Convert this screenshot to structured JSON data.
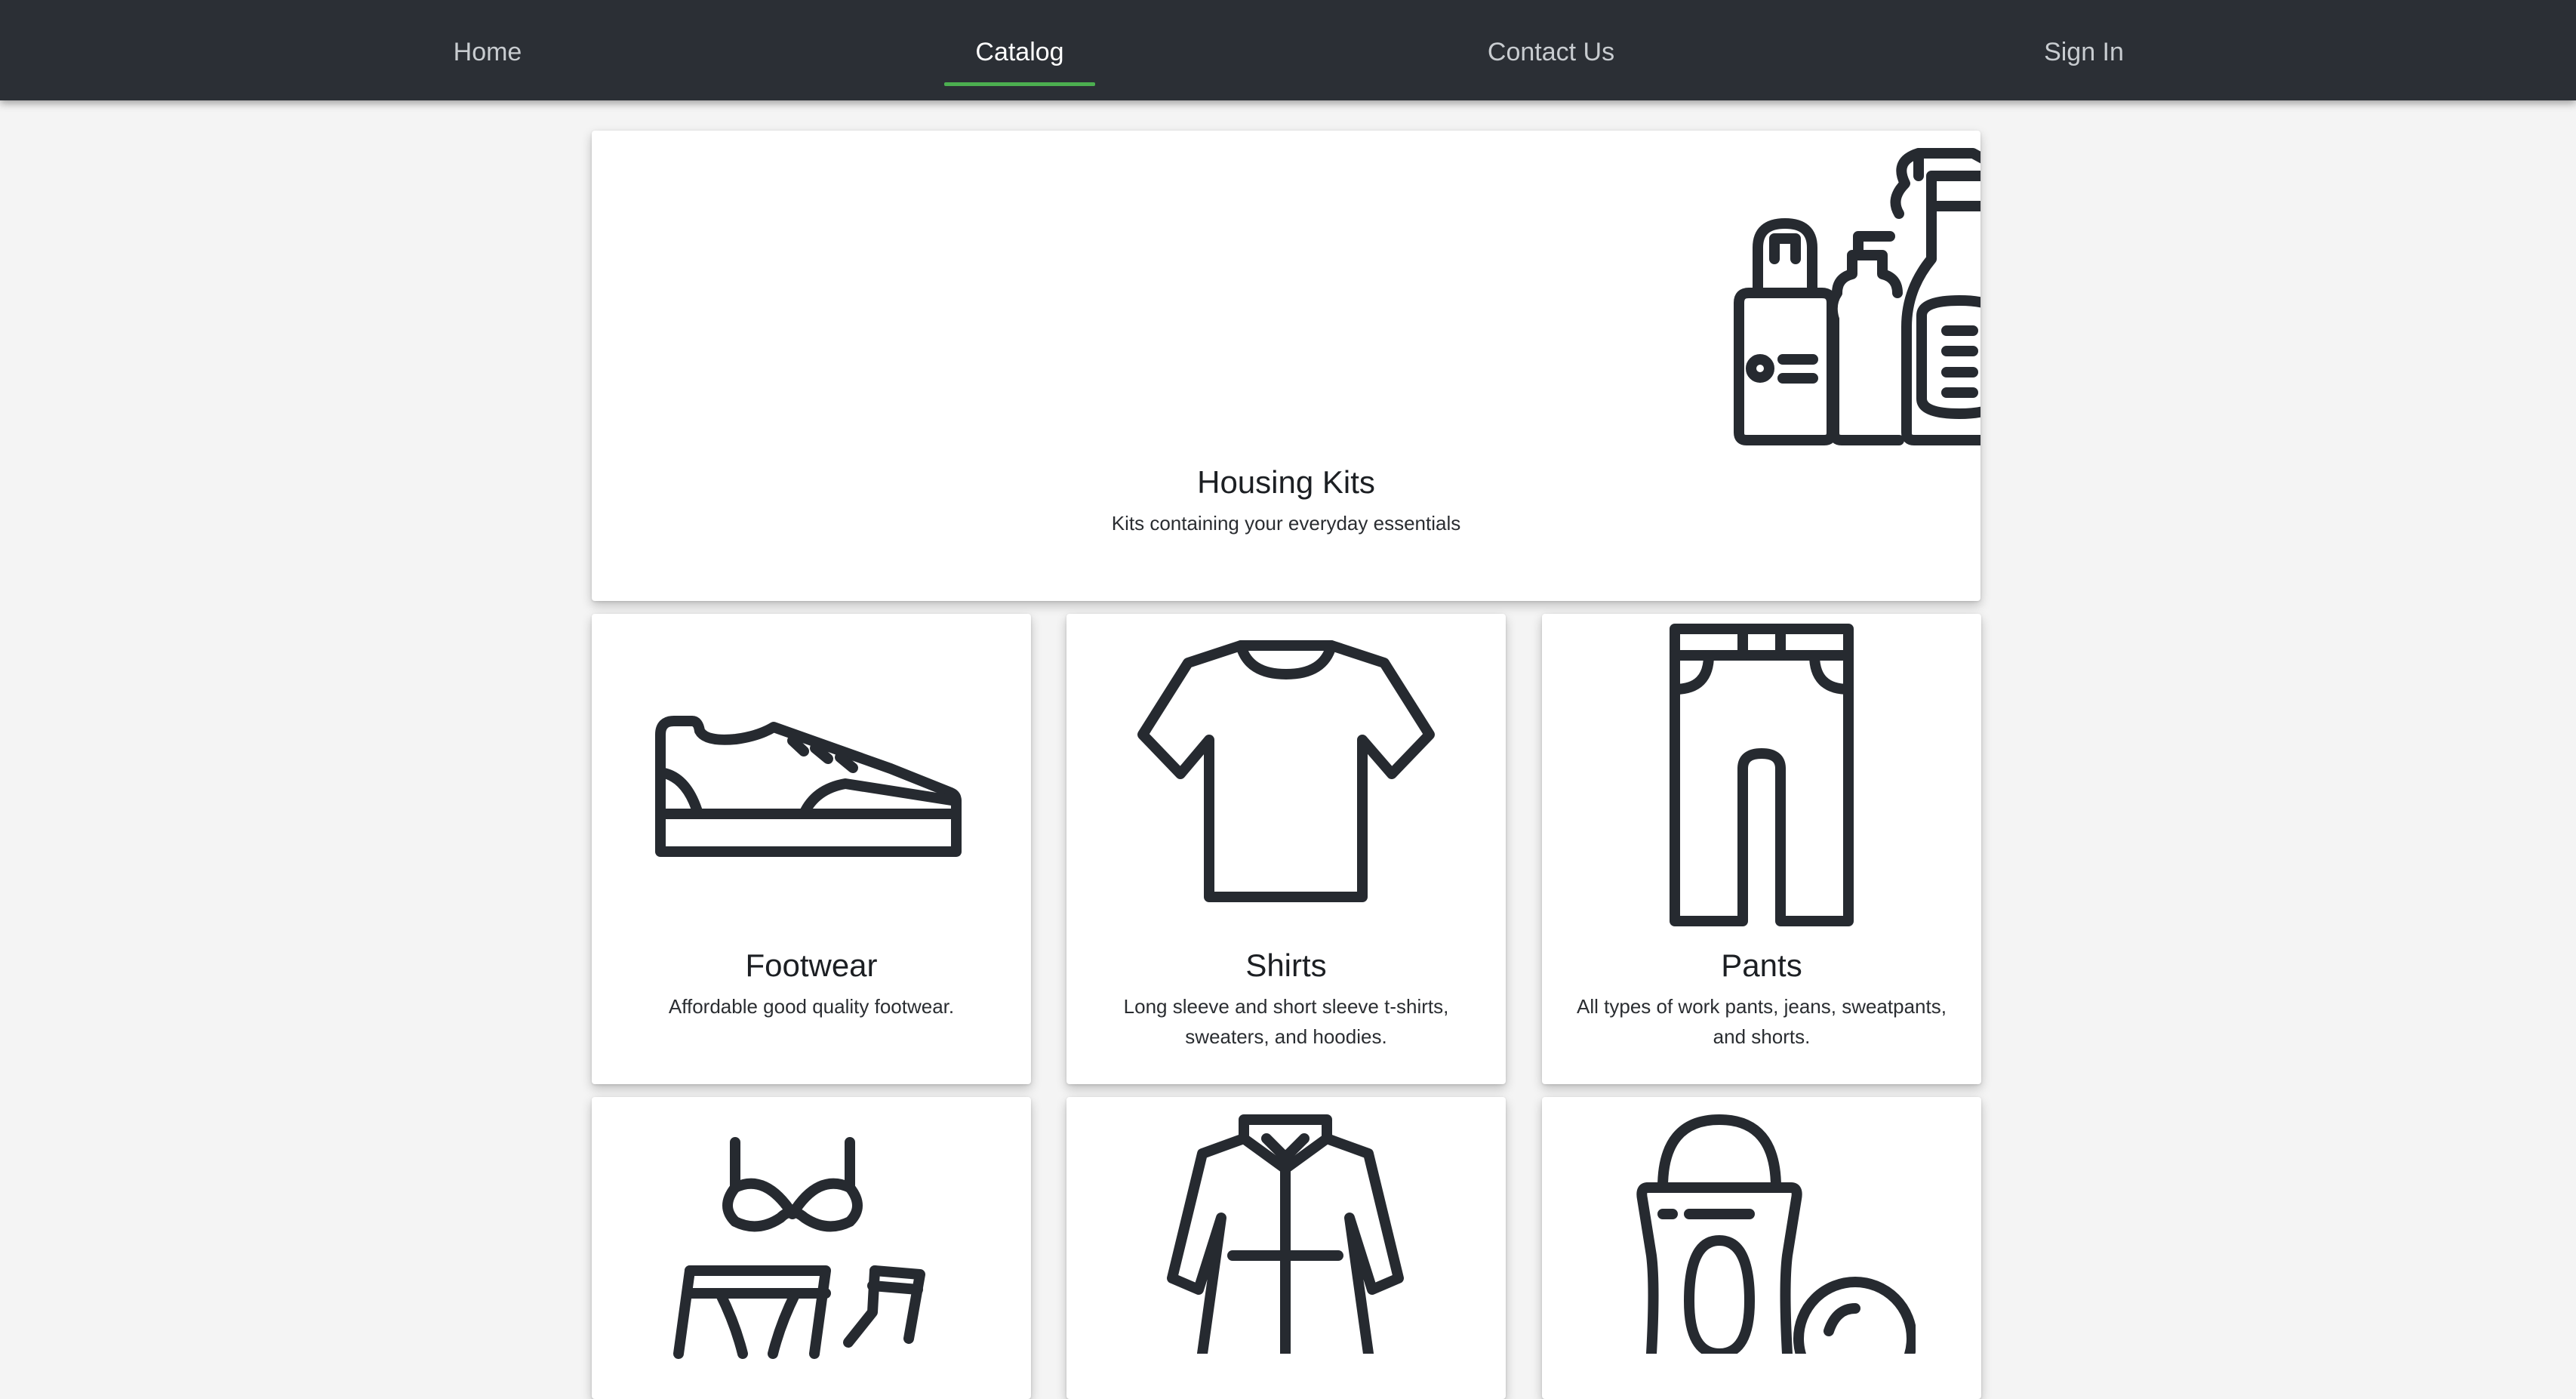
{
  "nav": {
    "home": "Home",
    "catalog": "Catalog",
    "contact": "Contact Us",
    "signin": "Sign In",
    "active_color": "#4caf50",
    "bar_color": "#2b2f35"
  },
  "featured": {
    "title": "Housing Kits",
    "description": "Kits containing your everyday essentials",
    "icon": "cleaning-bottles-icon"
  },
  "categories": [
    {
      "title": "Footwear",
      "description": "Affordable good quality footwear.",
      "icon": "sneaker-icon"
    },
    {
      "title": "Shirts",
      "description": "Long sleeve and short sleeve t-shirts, sweaters, and hoodies.",
      "icon": "tshirt-icon"
    },
    {
      "title": "Pants",
      "description": "All types of work pants, jeans, sweatpants, and shorts.",
      "icon": "pants-icon"
    },
    {
      "title": "",
      "description": "",
      "icon": "underwear-socks-icon"
    },
    {
      "title": "",
      "description": "",
      "icon": "coat-icon"
    },
    {
      "title": "",
      "description": "",
      "icon": "deodorant-icon"
    }
  ]
}
